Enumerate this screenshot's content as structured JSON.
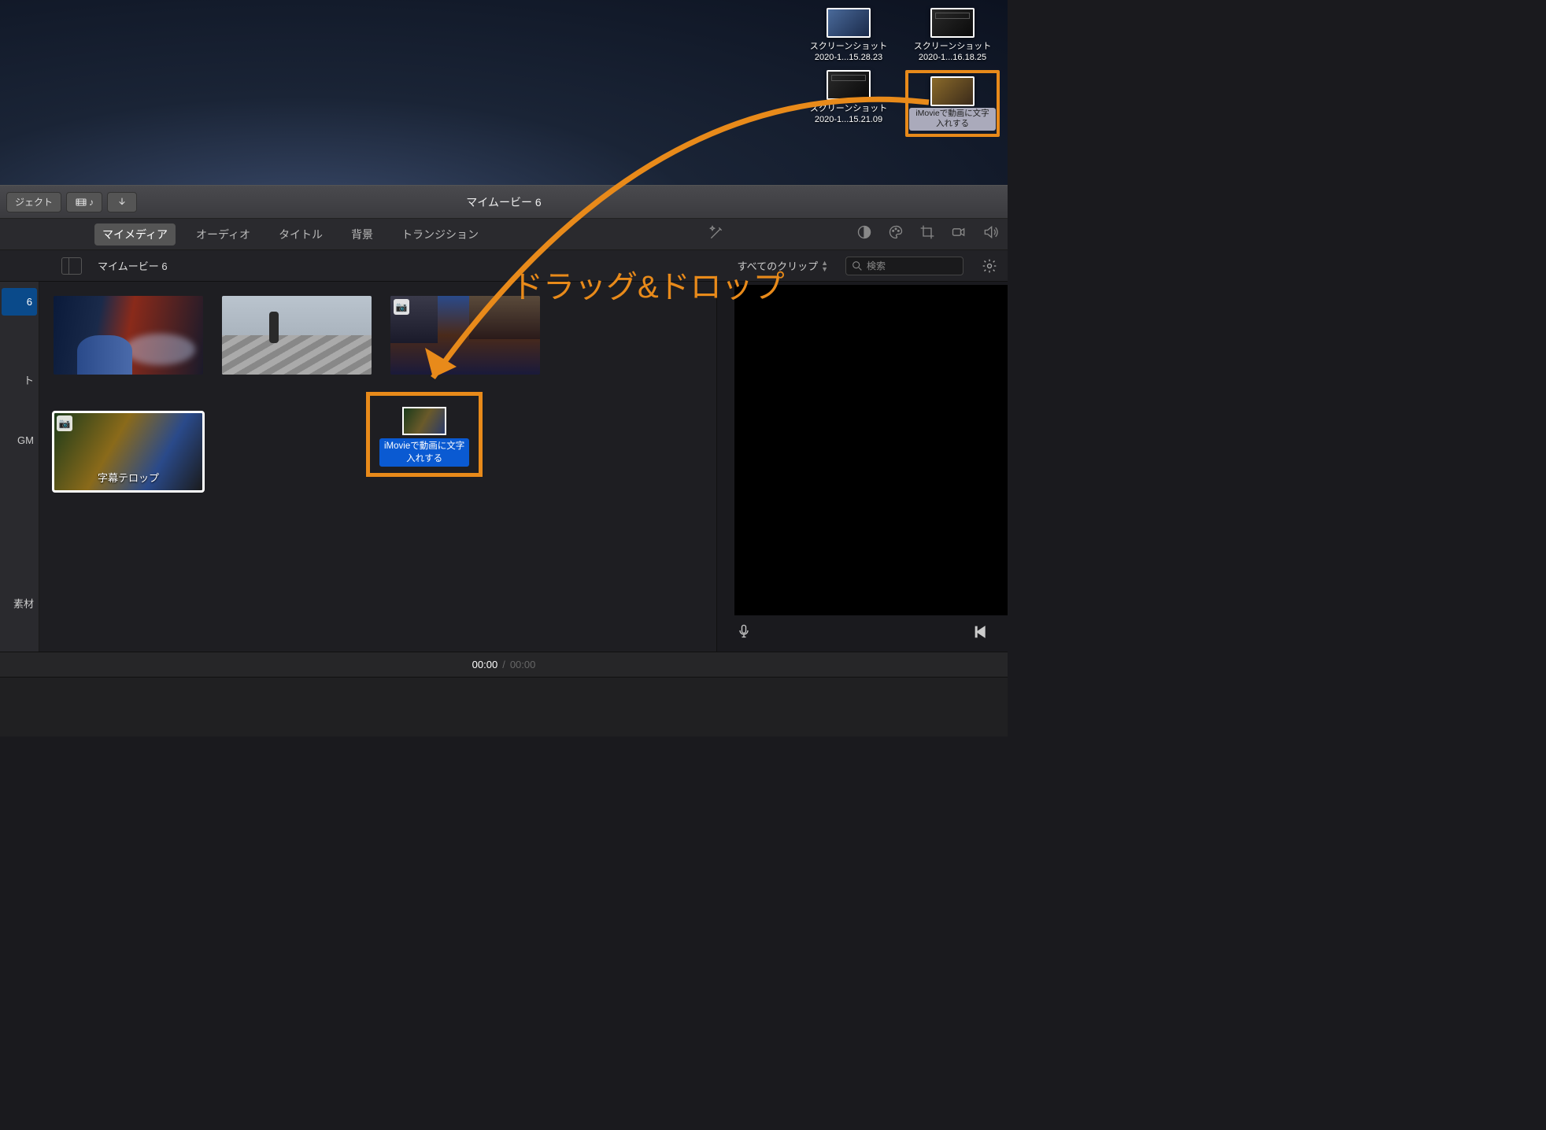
{
  "desktop": {
    "icons": [
      {
        "l1": "スクリーンショット",
        "l2": "2020-1...15.28.23"
      },
      {
        "l1": "スクリーンショット",
        "l2": "2020-1...16.18.25"
      },
      {
        "l1": "スクリーンショット",
        "l2": "2020-1...15.21.09"
      },
      {
        "l1": "iMovieで動画に文字",
        "l2": "入れする"
      }
    ]
  },
  "titlebar": {
    "project_btn": "ジェクト",
    "title": "マイムービー 6"
  },
  "tabs": {
    "mymedia": "マイメディア",
    "audio": "オーディオ",
    "titles": "タイトル",
    "background": "背景",
    "transition": "トランジション"
  },
  "filter": {
    "project_name": "マイムービー 6",
    "clip_filter": "すべてのクリップ",
    "search_placeholder": "検索"
  },
  "sidebar": {
    "item0": "6",
    "item1": "ト",
    "item2": "GM",
    "item3": "素材"
  },
  "clips": {
    "c4_text": "字幕テロップ"
  },
  "drop": {
    "l1": "iMovieで動画に文字",
    "l2": "入れする"
  },
  "timecode": {
    "current": "00:00",
    "sep": "/",
    "total": "00:00"
  },
  "annotation": {
    "text": "ドラッグ&ドロップ"
  }
}
